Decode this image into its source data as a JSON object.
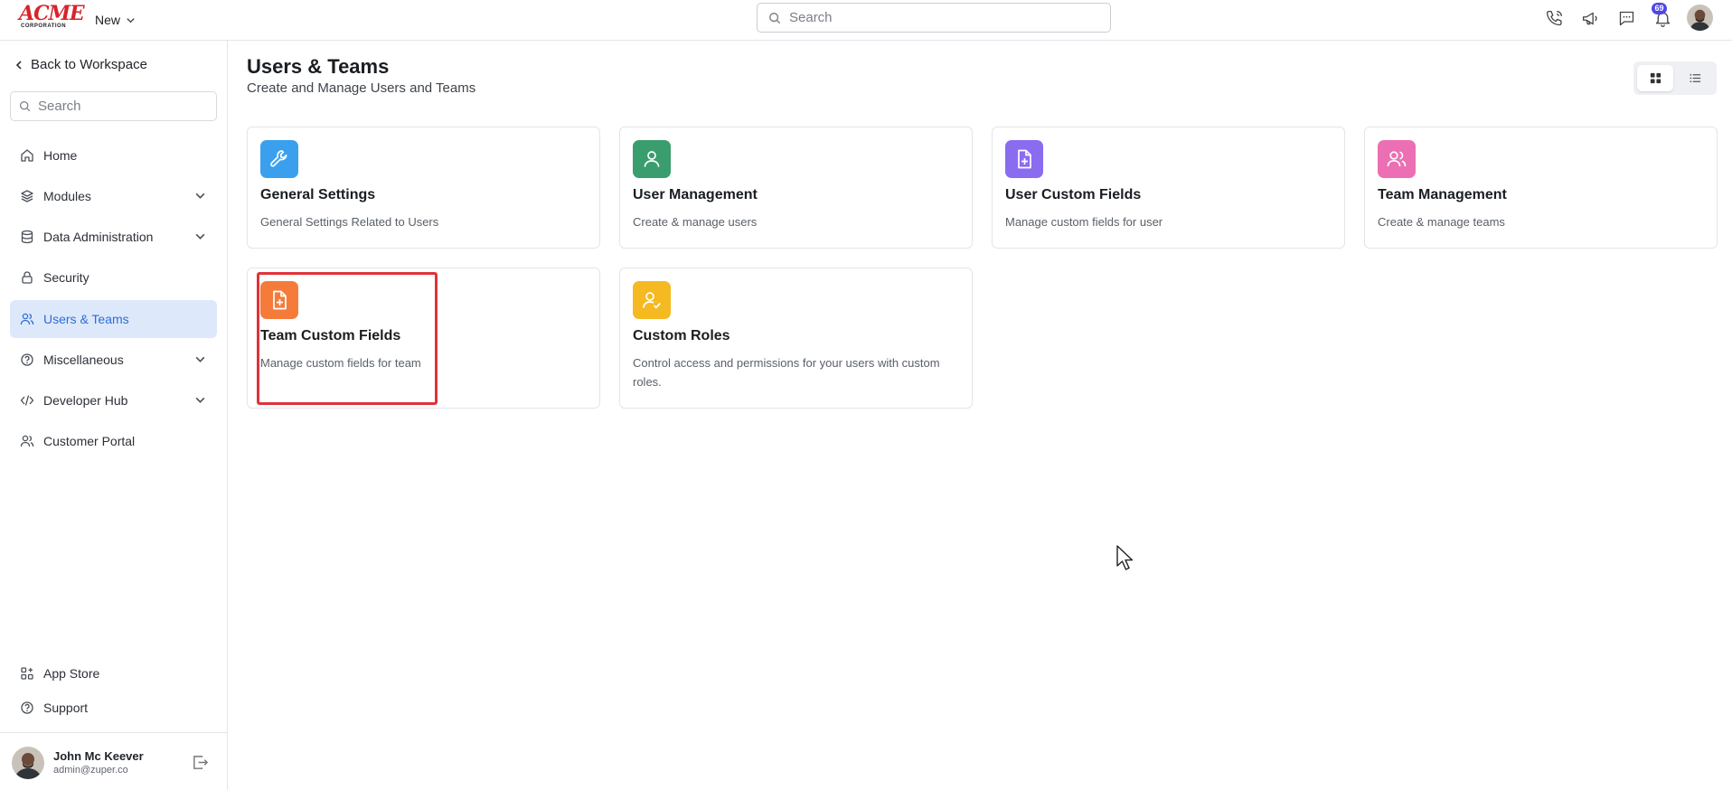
{
  "topbar": {
    "logo_text": "ACME",
    "logo_sub": "CORPORATION",
    "new_label": "New",
    "search_placeholder": "Search",
    "notification_count": "69"
  },
  "sidebar": {
    "back_label": "Back to Workspace",
    "search_placeholder": "Search",
    "items": [
      {
        "label": "Home",
        "icon": "home-icon"
      },
      {
        "label": "Modules",
        "icon": "layers-icon"
      },
      {
        "label": "Data Administration",
        "icon": "database-icon"
      },
      {
        "label": "Security",
        "icon": "lock-icon"
      },
      {
        "label": "Users & Teams",
        "icon": "users-icon",
        "active": true
      },
      {
        "label": "Miscellaneous",
        "icon": "help-circle-icon"
      },
      {
        "label": "Developer Hub",
        "icon": "code-icon"
      },
      {
        "label": "Customer Portal",
        "icon": "users-icon"
      }
    ],
    "footer_items": [
      {
        "label": "App Store",
        "icon": "apps-icon"
      },
      {
        "label": "Support",
        "icon": "help-circle-icon"
      }
    ],
    "user": {
      "name": "John Mc Keever",
      "email": "admin@zuper.co"
    }
  },
  "main": {
    "title": "Users & Teams",
    "subtitle": "Create and Manage Users and Teams",
    "cards": [
      {
        "title": "General Settings",
        "desc": "General Settings Related to Users",
        "color": "#3aa0ee",
        "icon": "wrench-icon"
      },
      {
        "title": "User Management",
        "desc": "Create & manage users",
        "color": "#3a9d6e",
        "icon": "user-icon"
      },
      {
        "title": "User Custom Fields",
        "desc": "Manage custom fields for user",
        "color": "#8a6cf0",
        "icon": "file-plus-icon"
      },
      {
        "title": "Team Management",
        "desc": "Create & manage teams",
        "color": "#ec6fb3",
        "icon": "users-icon"
      },
      {
        "title": "Team Custom Fields",
        "desc": "Manage custom fields for team",
        "color": "#f57b3b",
        "icon": "file-plus-icon"
      },
      {
        "title": "Custom Roles",
        "desc": "Control access and permissions for your users with custom roles.",
        "color": "#f5b921",
        "icon": "user-check-icon"
      }
    ]
  },
  "colors": {
    "accent": "#2c6cd6",
    "active_bg": "#dde9fb",
    "highlight": "#e0323a",
    "logo": "#d6252c"
  }
}
